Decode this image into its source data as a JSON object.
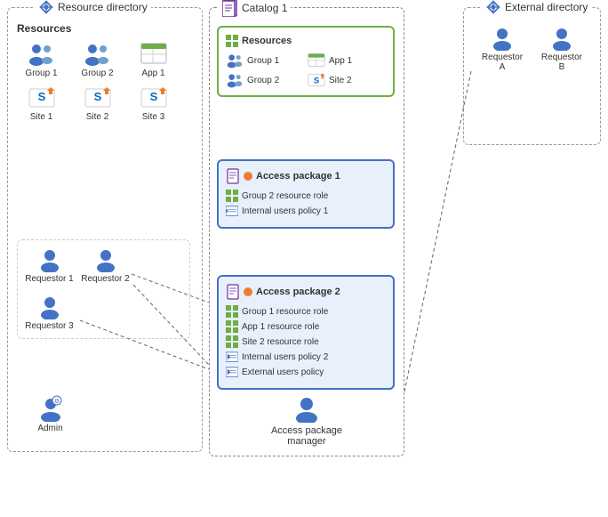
{
  "resourceDirectory": {
    "label": "Resource directory",
    "resources": {
      "title": "Resources",
      "items": [
        {
          "id": "group1",
          "label": "Group 1",
          "type": "group"
        },
        {
          "id": "group2",
          "label": "Group 2",
          "type": "group"
        },
        {
          "id": "app1",
          "label": "App 1",
          "type": "app"
        },
        {
          "id": "site1",
          "label": "Site 1",
          "type": "site"
        },
        {
          "id": "site2",
          "label": "Site 2",
          "type": "site"
        },
        {
          "id": "site3",
          "label": "Site 3",
          "type": "site"
        }
      ]
    },
    "requestors": {
      "items": [
        {
          "id": "req1",
          "label": "Requestor 1",
          "type": "person"
        },
        {
          "id": "req2",
          "label": "Requestor 2",
          "type": "person"
        },
        {
          "id": "req3",
          "label": "Requestor 3",
          "type": "person"
        }
      ]
    },
    "admin": {
      "label": "Admin",
      "type": "person-admin"
    }
  },
  "catalog": {
    "label": "Catalog 1",
    "resources": {
      "title": "Resources",
      "items": [
        {
          "id": "cg1",
          "label": "Group 1",
          "type": "group"
        },
        {
          "id": "ca1",
          "label": "App 1",
          "type": "app"
        },
        {
          "id": "cg2",
          "label": "Group 2",
          "type": "group"
        },
        {
          "id": "cs2",
          "label": "Site 2",
          "type": "site"
        }
      ]
    },
    "accessPackage1": {
      "label": "Access package 1",
      "items": [
        {
          "label": "Group 2 resource role",
          "type": "resource-role"
        },
        {
          "label": "Internal users policy 1",
          "type": "policy"
        }
      ]
    },
    "accessPackage2": {
      "label": "Access package 2",
      "items": [
        {
          "label": "Group 1 resource role",
          "type": "resource-role"
        },
        {
          "label": "App 1 resource role",
          "type": "resource-role"
        },
        {
          "label": "Site 2 resource role",
          "type": "resource-role"
        },
        {
          "label": "Internal users policy 2",
          "type": "policy"
        },
        {
          "label": "External users policy",
          "type": "policy"
        }
      ]
    },
    "accessPackageManager": {
      "label": "Access package\nmanager"
    }
  },
  "externalDirectory": {
    "label": "External directory",
    "requestors": [
      {
        "id": "reqA",
        "label": "Requestor A"
      },
      {
        "id": "reqB",
        "label": "Requestor B"
      }
    ]
  }
}
